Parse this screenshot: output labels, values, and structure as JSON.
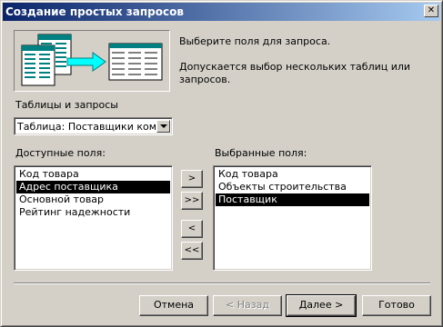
{
  "window": {
    "title": "Создание простых запросов",
    "close_glyph": "✕"
  },
  "intro": {
    "line1": "Выберите поля для запроса.",
    "line2": "Допускается выбор нескольких таблиц или",
    "line3": "запросов."
  },
  "tables": {
    "label": "Таблицы и запросы",
    "selected": "Таблица: Поставщики компании"
  },
  "available": {
    "label": "Доступные поля:",
    "items": [
      "Код товара",
      "Адрес поставщика",
      "Основной товар",
      "Рейтинг надежности"
    ],
    "selected_index": 1
  },
  "chosen": {
    "label": "Выбранные поля:",
    "items": [
      "Код товара",
      "Объекты строительства",
      "Поставщик"
    ],
    "selected_index": 2
  },
  "transfer": {
    "add_one": ">",
    "add_all": ">>",
    "remove_one": "<",
    "remove_all": "<<"
  },
  "buttons": {
    "cancel": "Отмена",
    "back": "< Назад",
    "next": "Далее >",
    "finish": "Готово"
  },
  "colors": {
    "title_start": "#0a246a",
    "title_end": "#a6caf0",
    "arrow": "#00ffff",
    "table_header": "#008080"
  }
}
